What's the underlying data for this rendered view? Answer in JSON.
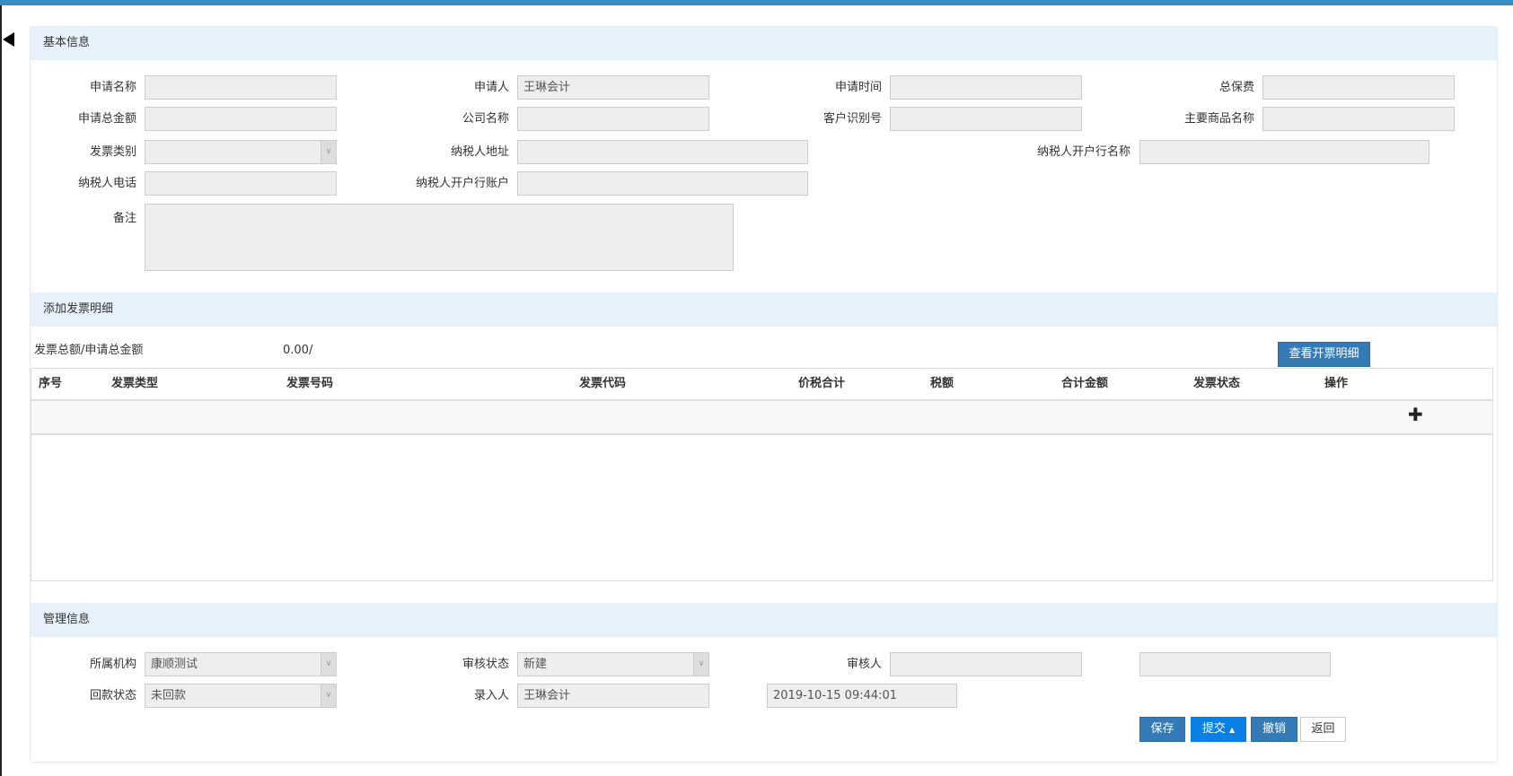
{
  "basic_info": {
    "title": "基本信息",
    "fields": {
      "apply_name": {
        "label": "申请名称",
        "value": ""
      },
      "applicant": {
        "label": "申请人",
        "value": "王琳会计"
      },
      "apply_time": {
        "label": "申请时间",
        "value": ""
      },
      "total_premium": {
        "label": "总保费",
        "value": ""
      },
      "apply_total_amount": {
        "label": "申请总金额",
        "value": ""
      },
      "company_name": {
        "label": "公司名称",
        "value": ""
      },
      "customer_id": {
        "label": "客户识别号",
        "value": ""
      },
      "main_goods": {
        "label": "主要商品名称",
        "value": ""
      },
      "invoice_category": {
        "label": "发票类别",
        "value": ""
      },
      "taxpayer_address": {
        "label": "纳税人地址",
        "value": ""
      },
      "taxpayer_bank_name": {
        "label": "纳税人开户行名称",
        "value": ""
      },
      "taxpayer_phone": {
        "label": "纳税人电话",
        "value": ""
      },
      "taxpayer_bank_account": {
        "label": "纳税人开户行账户",
        "value": ""
      },
      "remark": {
        "label": "备注",
        "value": ""
      }
    }
  },
  "invoice_detail": {
    "title": "添加发票明细",
    "summary_label": "发票总额/申请总金额",
    "summary_value": "0.00/",
    "view_button": "查看开票明细",
    "columns": [
      "序号",
      "发票类型",
      "发票号码",
      "发票代码",
      "价税合计",
      "税额",
      "合计金额",
      "发票状态",
      "操作"
    ],
    "add_icon": "plus-icon"
  },
  "management": {
    "title": "管理信息",
    "org": {
      "label": "所属机构",
      "value": "康顺测试"
    },
    "audit_status": {
      "label": "审核状态",
      "value": "新建"
    },
    "auditor": {
      "label": "审核人",
      "value": "",
      "extra": ""
    },
    "payment_status": {
      "label": "回款状态",
      "value": "未回款"
    },
    "entered_by": {
      "label": "录入人",
      "value": "王琳会计",
      "date": "2019-10-15 09:44:01"
    }
  },
  "actions": {
    "save": "保存",
    "submit": "提交",
    "cancel": "撤销",
    "back": "返回"
  },
  "colors": {
    "primary": "#337ab7",
    "submit": "#0a7fe6",
    "section_bg": "#e7f1fb",
    "top_bar": "#3a8bbf"
  }
}
